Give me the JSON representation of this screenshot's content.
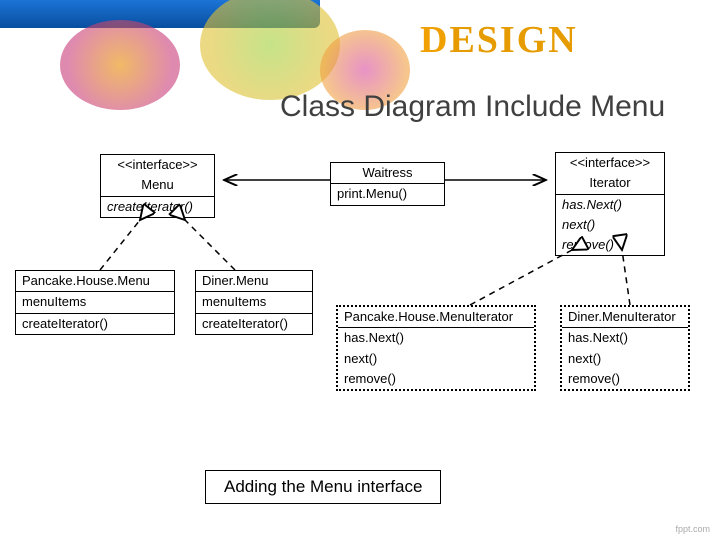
{
  "header": {
    "logo_text_d": "D",
    "logo_text_rest": "ESIGN",
    "title": "Class Diagram Include Menu"
  },
  "classes": {
    "menu": {
      "stereotype": "<<interface>>",
      "name": "Menu",
      "op": "createIterator()"
    },
    "waitress": {
      "name": "Waitress",
      "op": "print.Menu()"
    },
    "iterator": {
      "stereotype": "<<interface>>",
      "name": "Iterator",
      "op1": "has.Next()",
      "op2": "next()",
      "op3": "remove()"
    },
    "pancake": {
      "name": "Pancake.House.Menu",
      "attr": "menuItems",
      "op": "createIterator()"
    },
    "diner": {
      "name": "Diner.Menu",
      "attr": "menuItems",
      "op": "createIterator()"
    },
    "pancakeIt": {
      "name": "Pancake.House.MenuIterator",
      "op1": "has.Next()",
      "op2": "next()",
      "op3": "remove()"
    },
    "dinerIt": {
      "name": "Diner.MenuIterator",
      "op1": "has.Next()",
      "op2": "next()",
      "op3": "remove()"
    }
  },
  "caption": "Adding the Menu interface",
  "footer": "fppt.com"
}
